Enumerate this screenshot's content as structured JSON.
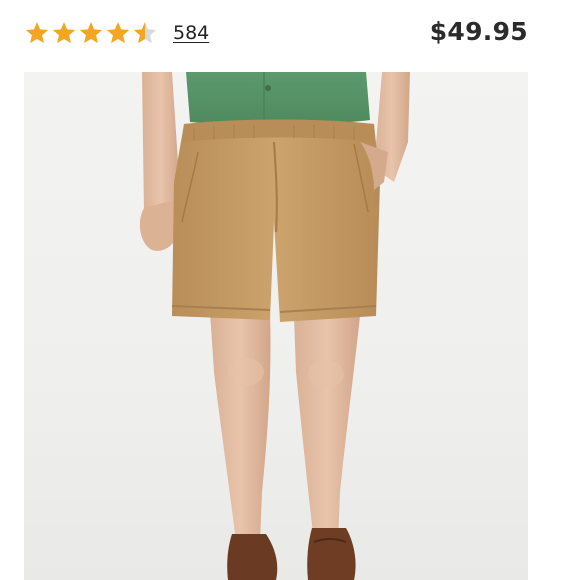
{
  "product": {
    "rating": 4.5,
    "rating_max": 5,
    "review_count": "584",
    "price": "$49.95"
  },
  "colors": {
    "star": "#f2a623",
    "star_empty": "#d9d9d9",
    "shorts": "#c79f6a",
    "shirt": "#5e9a6e",
    "shoes": "#6b3a22",
    "background": "#f1f1ef"
  },
  "icons": {
    "star": "star-icon",
    "half_star": "half-star-icon"
  }
}
